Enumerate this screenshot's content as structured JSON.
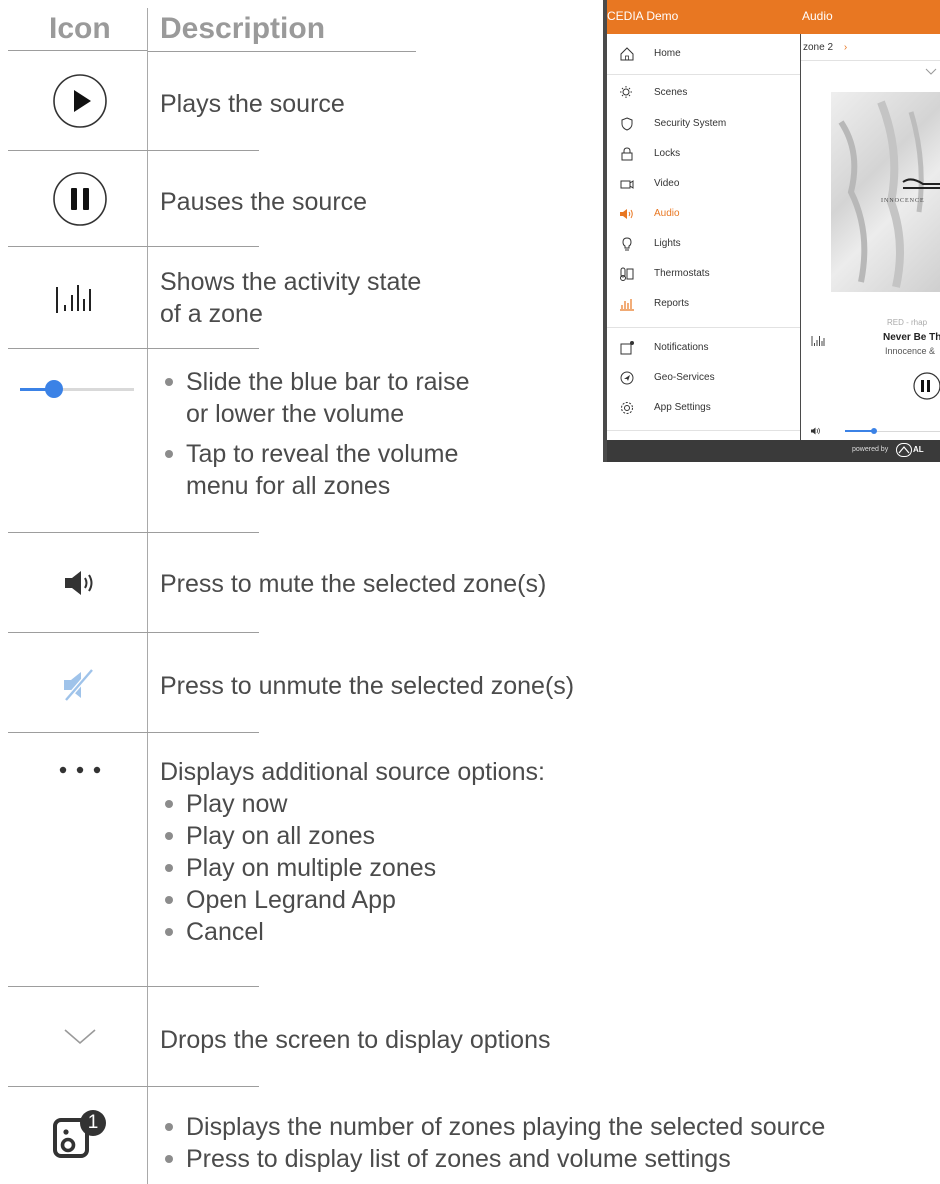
{
  "table": {
    "header_icon": "Icon",
    "header_description": "Description",
    "rows": [
      {
        "icon": "play-circle-icon",
        "text": "Plays the source"
      },
      {
        "icon": "pause-circle-icon",
        "text": "Pauses the source"
      },
      {
        "icon": "activity-bars-icon",
        "lines": [
          "Shows the activity state",
          "of a zone"
        ]
      },
      {
        "icon": "volume-slider-icon",
        "bullets": [
          "Slide the blue bar to raise",
          "or lower the volume",
          "Tap to reveal the volume",
          "menu for all zones"
        ],
        "volume_level": 0.3,
        "accent": "#3b82e6"
      },
      {
        "icon": "speaker-icon",
        "text": "Press to mute the selected zone(s)"
      },
      {
        "icon": "muted-speaker-icon",
        "text": "Press to unmute the selected zone(s)",
        "color": "#9fc3ea"
      },
      {
        "icon": "more-dots-icon",
        "text": "Displays additional source options:",
        "bullets": [
          "Play now",
          "Play on all zones",
          "Play on multiple zones",
          "Open Legrand App",
          "Cancel"
        ]
      },
      {
        "icon": "chevron-down-icon",
        "text": "Drops the screen to display options"
      },
      {
        "icon": "zones-speaker-icon",
        "badge": "1",
        "bullets": [
          "Displays the number of zones playing the selected source",
          "Press to display list of zones and volume settings"
        ]
      }
    ]
  },
  "app": {
    "title": "CEDIA Demo",
    "section": "Audio",
    "accent": "#e87722",
    "nav": [
      {
        "label": "Home",
        "icon": "home-icon"
      },
      {
        "label": "Scenes",
        "icon": "scenes-icon"
      },
      {
        "label": "Security System",
        "icon": "shield-icon"
      },
      {
        "label": "Locks",
        "icon": "lock-icon"
      },
      {
        "label": "Video",
        "icon": "video-icon"
      },
      {
        "label": "Audio",
        "icon": "audio-icon",
        "active": true
      },
      {
        "label": "Lights",
        "icon": "bulb-icon"
      },
      {
        "label": "Thermostats",
        "icon": "thermostat-icon"
      },
      {
        "label": "Reports",
        "icon": "reports-icon"
      },
      {
        "label": "Notifications",
        "icon": "notifications-icon"
      },
      {
        "label": "Geo-Services",
        "icon": "geo-icon"
      },
      {
        "label": "App Settings",
        "icon": "gear-icon"
      }
    ],
    "zone": "zone 2",
    "album_text": "INNOCENCE",
    "source_line": "RED - rhap",
    "track_title": "Never Be Th",
    "track_album": "Innocence &",
    "volume_level": 0.3,
    "footer": "powered by",
    "footer_brand": "AL"
  }
}
